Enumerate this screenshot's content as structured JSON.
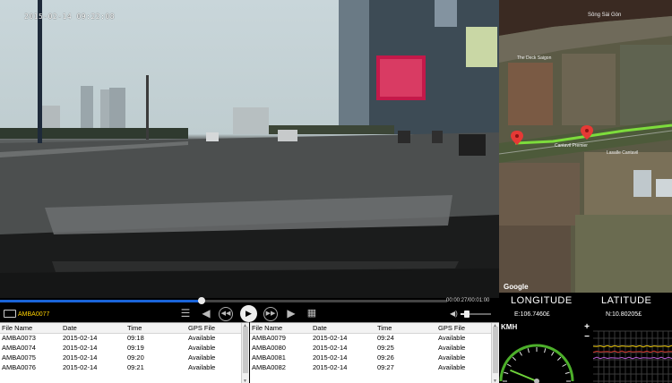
{
  "video": {
    "timestamp": "2015-02-14 09:22:08"
  },
  "map": {
    "river_label": "Sông Sài Gòn",
    "place_labels": [
      "The Deck Saigon",
      "Cantavil Premier",
      "Lasalle Cantavil"
    ],
    "google_label": "Google",
    "route_color": "#7ddc3c",
    "marker_color": "#e53935"
  },
  "gps": {
    "longitude_label": "LONGITUDE",
    "latitude_label": "LATITUDE",
    "longitude_value": "E:106.7460£",
    "latitude_value": "N:10.80205£"
  },
  "player": {
    "progress_fraction": 0.45,
    "time_readout": "00:00:27/00:01:00",
    "current_file": "AMBA0077",
    "volume_fraction": 0.2,
    "icons": {
      "camera": "camera-icon",
      "playlist": "playlist-icon",
      "back": "back-arrow-icon",
      "rewind": "rewind-icon",
      "play": "play-icon",
      "fast_forward": "fast-forward-icon",
      "forward": "forward-arrow-icon",
      "delete": "trash-icon",
      "volume": "volume-icon"
    }
  },
  "file_tables": {
    "columns": [
      "File Name",
      "Date",
      "Time",
      "GPS File"
    ],
    "left": [
      [
        "AMBA0073",
        "2015-02-14",
        "09:18",
        "Available"
      ],
      [
        "AMBA0074",
        "2015-02-14",
        "09:19",
        "Available"
      ],
      [
        "AMBA0075",
        "2015-02-14",
        "09:20",
        "Available"
      ],
      [
        "AMBA0076",
        "2015-02-14",
        "09:21",
        "Available"
      ]
    ],
    "right": [
      [
        "AMBA0079",
        "2015-02-14",
        "09:24",
        "Available"
      ],
      [
        "AMBA0080",
        "2015-02-14",
        "09:25",
        "Available"
      ],
      [
        "AMBA0081",
        "2015-02-14",
        "09:26",
        "Available"
      ],
      [
        "AMBA0082",
        "2015-02-14",
        "09:27",
        "Available"
      ]
    ]
  },
  "speedometer": {
    "unit": "KMH",
    "speed_value": 30,
    "max_value": 240,
    "accent": "#4caf2a"
  },
  "accel": {
    "plus": "+",
    "minus": "−",
    "series_colors": [
      "#e6c200",
      "#d2342a",
      "#b95bd6"
    ]
  }
}
